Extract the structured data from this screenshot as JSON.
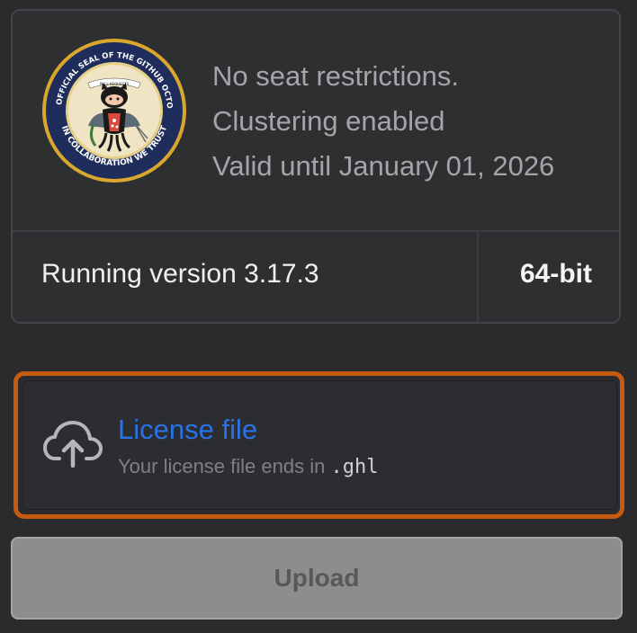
{
  "license": {
    "seal_text": {
      "outer": "THE OFFICIAL SEAL OF THE GITHUB OCTOCAT",
      "bottom": "IN COLLABORATION WE TRUST",
      "banner": "PULL REQUESTS"
    },
    "lines": [
      "No seat restrictions.",
      "Clustering enabled",
      "Valid until January 01, 2026"
    ],
    "version_text": "Running version 3.17.3",
    "architecture": "64-bit"
  },
  "upload": {
    "title": "License file",
    "hint_prefix": "Your license file ends in ",
    "hint_extension": ".ghl",
    "icon": "cloud-upload-icon",
    "highlight_color": "#c55a11"
  },
  "actions": {
    "upload_label": "Upload"
  }
}
